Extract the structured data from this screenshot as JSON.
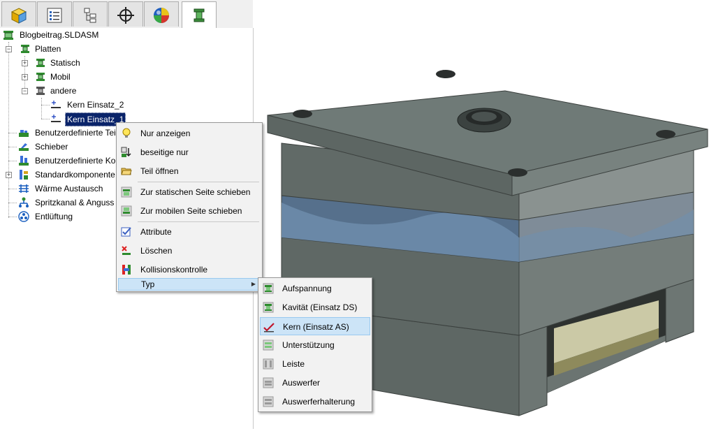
{
  "tabs": [
    {
      "icon": "part-cube-icon"
    },
    {
      "icon": "property-list-icon"
    },
    {
      "icon": "configuration-tree-icon"
    },
    {
      "icon": "crosshair-icon"
    },
    {
      "icon": "appearance-ball-icon"
    },
    {
      "icon": "mold-plates-icon",
      "active": true
    }
  ],
  "tree": {
    "root": "Blogbeitrag.SLDASM",
    "platten": "Platten",
    "statisch": "Statisch",
    "mobil": "Mobil",
    "andere": "andere",
    "kern2": "Kern Einsatz_2",
    "kern1": "Kern Einsatz_1",
    "benutzer_teile": "Benutzerdefinierte Tei",
    "schieber": "Schieber",
    "benutzer_komp": "Benutzerdefinierte Kor",
    "standard": "Standardkomponente",
    "waerme": "Wärme Austausch",
    "spritz": "Spritzkanal & Anguss",
    "entlueftung": "Entlüftung"
  },
  "context_menu": {
    "nur_anzeigen": "Nur anzeigen",
    "beseitige_nur": "beseitige nur",
    "teil_oeffnen": "Teil öffnen",
    "statische_seite": "Zur statischen Seite schieben",
    "mobile_seite": "Zur mobilen Seite schieben",
    "attribute": "Attribute",
    "loeschen": "Löschen",
    "kollision": "Kollisionskontrolle",
    "typ": "Typ"
  },
  "submenu": {
    "aufspannung": "Aufspannung",
    "kavitaet": "Kavität (Einsatz DS)",
    "kern": "Kern (Einsatz AS)",
    "unterstuetzung": "Unterstützung",
    "leiste": "Leiste",
    "auswerfer": "Auswerfer",
    "auswerferhalterung": "Auswerferhalterung"
  },
  "colors": {
    "selection": "#0a246a",
    "menu_highlight": "#cce4f7",
    "plate": "#6f7a77",
    "insert_blue": "#6f8fae"
  }
}
